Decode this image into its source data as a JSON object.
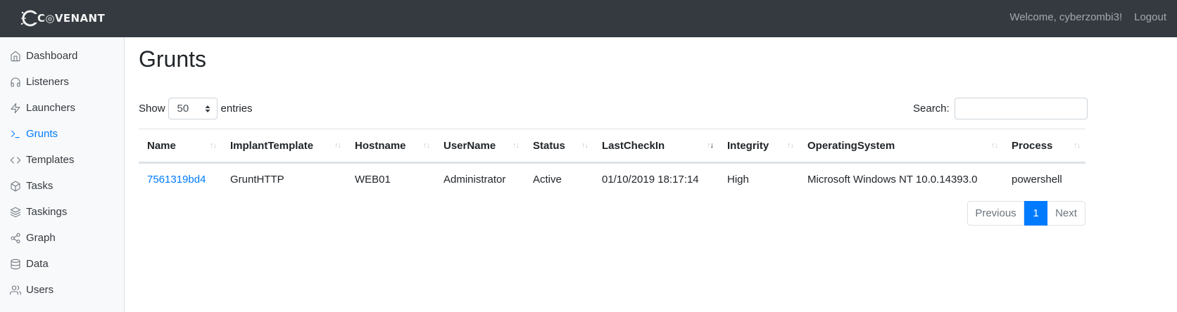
{
  "header": {
    "brand": "C◎VENANT",
    "welcome": "Welcome, cyberzombi3!",
    "logout": "Logout"
  },
  "sidebar": {
    "items": [
      {
        "label": "Dashboard",
        "icon": "home-icon"
      },
      {
        "label": "Listeners",
        "icon": "headphones-icon"
      },
      {
        "label": "Launchers",
        "icon": "zap-icon"
      },
      {
        "label": "Grunts",
        "icon": "terminal-icon"
      },
      {
        "label": "Templates",
        "icon": "code-icon"
      },
      {
        "label": "Tasks",
        "icon": "box-icon"
      },
      {
        "label": "Taskings",
        "icon": "layers-icon"
      },
      {
        "label": "Graph",
        "icon": "share-icon"
      },
      {
        "label": "Data",
        "icon": "database-icon"
      },
      {
        "label": "Users",
        "icon": "users-icon"
      }
    ],
    "active": "Grunts",
    "active_color": "#007bff"
  },
  "main": {
    "title": "Grunts",
    "show_label": "Show",
    "entries_value": "50",
    "entries_label": "entries",
    "search_label": "Search:",
    "search_value": "",
    "columns": [
      "Name",
      "ImplantTemplate",
      "Hostname",
      "UserName",
      "Status",
      "LastCheckIn",
      "Integrity",
      "OperatingSystem",
      "Process"
    ],
    "sorted_column": "LastCheckIn",
    "rows": [
      [
        "7561319bd4",
        "GruntHTTP",
        "WEB01",
        "Administrator",
        "Active",
        "01/10/2019 18:17:14",
        "High",
        "Microsoft Windows NT 10.0.14393.0",
        "powershell"
      ]
    ],
    "pagination": {
      "previous": "Previous",
      "current": "1",
      "next": "Next"
    }
  },
  "colors": {
    "topbar": "#343a40",
    "link": "#007bff",
    "sidebar_bg": "#f8f9fa"
  }
}
